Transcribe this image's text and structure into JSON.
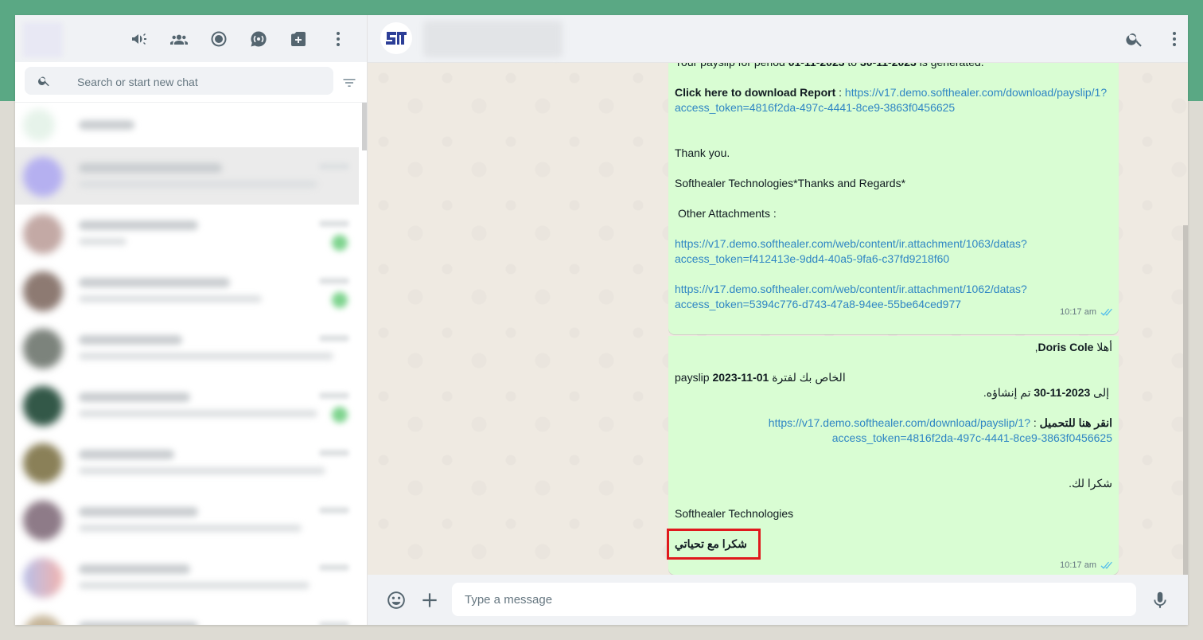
{
  "sidebar": {
    "search": {
      "placeholder": "Search or start new chat"
    },
    "header_icons": [
      "megaphone-icon",
      "community-icon",
      "status-icon",
      "channels-icon",
      "new-chat-icon",
      "menu-icon"
    ]
  },
  "conversation": {
    "header_icons": [
      "search-icon",
      "menu-icon"
    ],
    "messages": [
      {
        "lines": {
          "period_prefix": "Your payslip for period ",
          "period_start": "01-11-2023",
          "period_to": " to ",
          "period_end": "30-11-2023",
          "period_suffix": " is generated.",
          "download_label": "Click here to download Report",
          "download_sep": " : ",
          "download_link_1": "https://v17.demo.softhealer.com/download/payslip/1?",
          "download_link_2": "access_token=4816f2da-497c-4441-8ce9-3863f0456625",
          "thanks": "Thank you.",
          "regards": "Softhealer Technologies*Thanks and Regards*",
          "other_attachments": "Other Attachments :",
          "attach1_line1": "https://v17.demo.softhealer.com/web/content/ir.attachment/1063/datas?",
          "attach1_line2": "access_token=f412413e-9dd4-40a5-9fa6-c37fd9218f60",
          "attach2_line1": "https://v17.demo.softhealer.com/web/content/ir.attachment/1062/datas?",
          "attach2_line2": "access_token=5394c776-d743-47a8-94ee-55be64ced977"
        },
        "time": "10:17 am"
      },
      {
        "lines": {
          "greeting_word": "أهلا",
          "greeting_name": "Doris Cole",
          "greeting_comma": ",",
          "payslip_word": "payslip",
          "period_start": "2023-11-01",
          "period_text": "الخاص بك لفترة",
          "to_word": "إلى",
          "period_end": "2023-11-30",
          "generated_text": "تم إنشاؤه.",
          "download_label": "انقر هنا للتحميل",
          "download_sep": " : ",
          "download_link_1": "https://v17.demo.softhealer.com/download/payslip/1?",
          "download_link_2": "access_token=4816f2da-497c-4441-8ce9-3863f0456625",
          "thanks": "شكرا لك.",
          "company": "Softhealer Technologies",
          "regards": "شكرا مع تحياتي"
        },
        "time": "10:17 am"
      }
    ]
  },
  "composer": {
    "placeholder": "Type a message",
    "icons": [
      "emoji-icon",
      "attach-icon",
      "microphone-icon"
    ]
  },
  "colors": {
    "top_band": "#5aa884",
    "bubble_outgoing": "#d9fdd3",
    "link": "#2f86c4",
    "highlight": "#e0191d",
    "read_ticks": "#53bdeb"
  }
}
